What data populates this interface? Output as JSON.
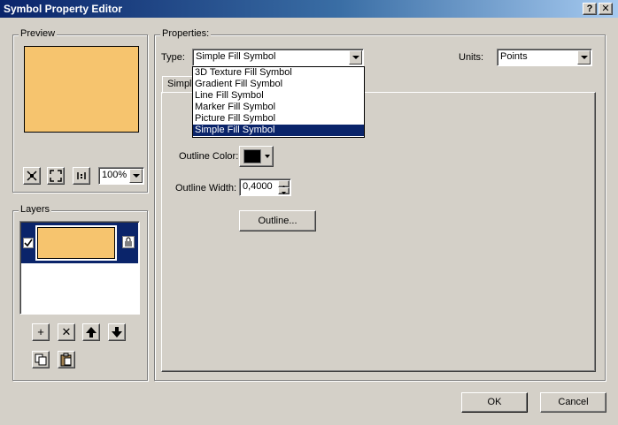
{
  "window": {
    "title": "Symbol Property Editor",
    "help_glyph": "?",
    "close_glyph": "✕"
  },
  "preview": {
    "label": "Preview",
    "swatch_color": "#f6c46e",
    "zoom": "100%"
  },
  "layers": {
    "label": "Layers",
    "swatch_color": "#f6c46e",
    "checked": true,
    "selected_bg": "#0a246a"
  },
  "properties": {
    "label": "Properties:",
    "type_label": "Type:",
    "type_value": "Simple Fill Symbol",
    "type_options": [
      "3D Texture Fill Symbol",
      "Gradient Fill Symbol",
      "Line Fill Symbol",
      "Marker Fill Symbol",
      "Picture Fill Symbol",
      "Simple Fill Symbol"
    ],
    "units_label": "Units:",
    "units_value": "Points",
    "tab_label": "Simple",
    "outline_color_label": "Outline Color:",
    "outline_color": "#000000",
    "outline_width_label": "Outline Width:",
    "outline_width_value": "0,4000",
    "outline_button": "Outline..."
  },
  "footer": {
    "ok": "OK",
    "cancel": "Cancel"
  }
}
